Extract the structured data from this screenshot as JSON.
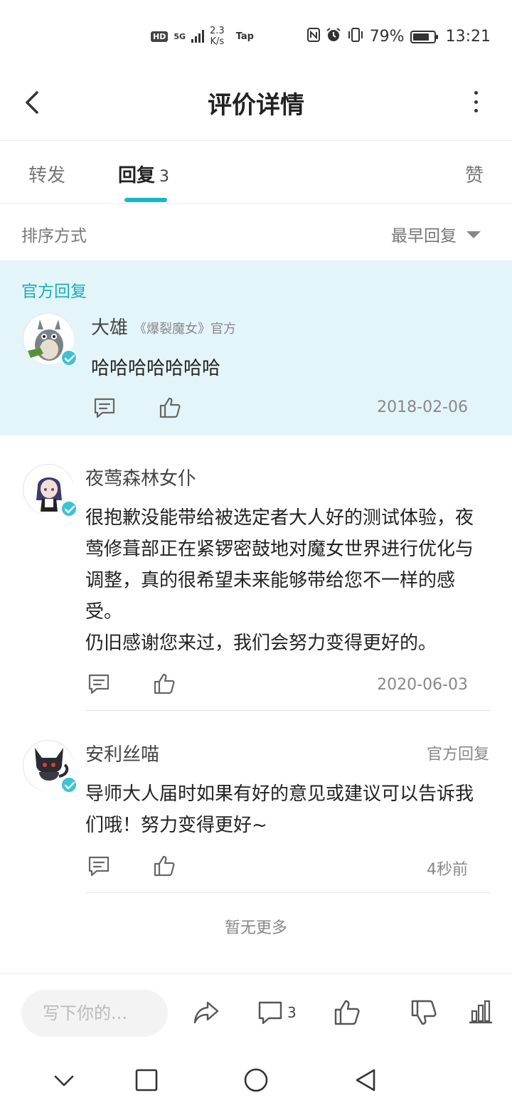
{
  "status_bar": {
    "hd": "HD",
    "network": "5G",
    "speed_value": "2.3",
    "speed_unit": "K/s",
    "tap_label": "Tap",
    "battery": "79%",
    "battery_level": 0.79,
    "time": "13:21"
  },
  "header": {
    "title": "评价详情"
  },
  "tabs": {
    "forward": "转发",
    "reply": "回复",
    "reply_count": "3",
    "like": "赞"
  },
  "sort": {
    "label": "排序方式",
    "value": "最早回复"
  },
  "official": {
    "tag": "官方回复",
    "author": "大雄",
    "subtitle": "《爆裂魔女》官方",
    "text": "哈哈哈哈哈哈哈",
    "date": "2018-02-06"
  },
  "replies": [
    {
      "author": "夜莺森林女仆",
      "text": "很抱歉没能带给被选定者大人好的测试体验，夜莺修葺部正在紧锣密鼓地对魔女世界进行优化与调整，真的很希望未来能够带给您不一样的感受。\n仍旧感谢您来过，我们会努力变得更好的。",
      "date": "2020-06-03"
    },
    {
      "author": "安利丝喵",
      "badge": "官方回复",
      "text": "导师大人届时如果有好的意见或建议可以告诉我们哦！努力变得更好~",
      "date": "4秒前"
    }
  ],
  "footer": {
    "no_more": "暂无更多"
  },
  "bottom_bar": {
    "input_placeholder": "写下你的...",
    "comment_count": "3"
  },
  "colors": {
    "accent": "#14b9c8",
    "official_bg": "#e4f5f9",
    "official_text": "#15aebf"
  }
}
